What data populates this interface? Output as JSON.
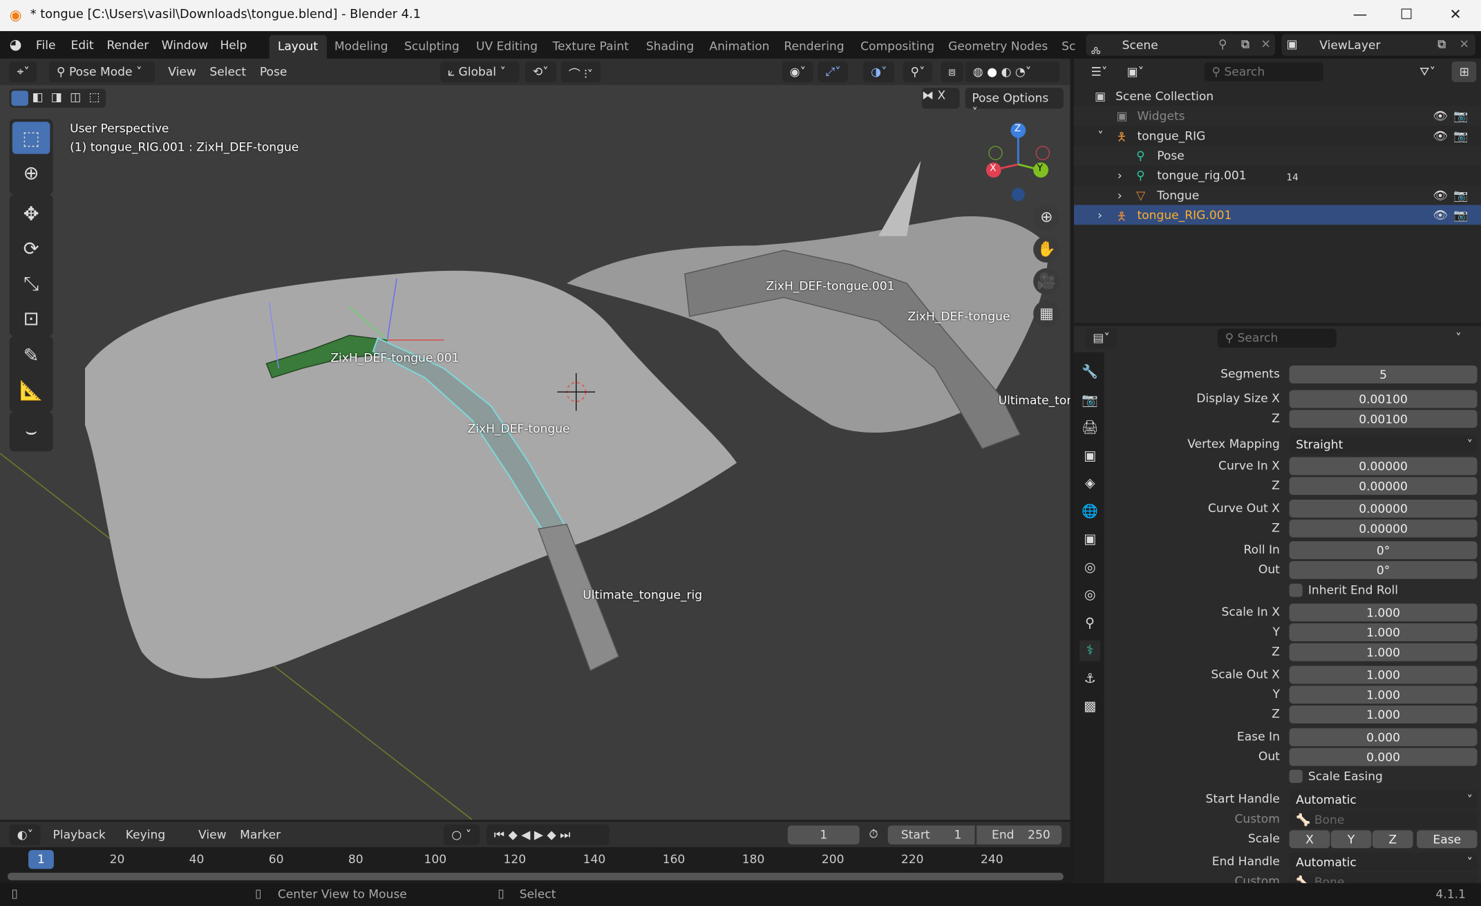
{
  "window": {
    "title": "* tongue [C:\\Users\\vasil\\Downloads\\tongue.blend] - Blender 4.1",
    "controls": [
      "minimize-icon",
      "maximize-icon",
      "close-icon"
    ]
  },
  "menubar": {
    "menus": [
      "File",
      "Edit",
      "Render",
      "Window",
      "Help"
    ],
    "workspaces": [
      "Layout",
      "Modeling",
      "Sculpting",
      "UV Editing",
      "Texture Paint",
      "Shading",
      "Animation",
      "Rendering",
      "Compositing",
      "Geometry Nodes",
      "Sc"
    ],
    "active_workspace": "Layout",
    "scene": "Scene",
    "view_layer": "ViewLayer"
  },
  "viewport_header": {
    "mode": "Pose Mode",
    "menus": [
      "View",
      "Select",
      "Pose"
    ],
    "orientation": "Global",
    "pose_options": "Pose Options",
    "x_mirror": "X"
  },
  "viewport": {
    "perspective": "User Perspective",
    "object_info": "(1) tongue_RIG.001 : ZixH_DEF-tongue",
    "bone_labels": [
      "ZixH_DEF-tongue.001",
      "ZixH_DEF-tongue",
      "Ultimate_tongue_rig",
      "ZixH_DEF-tongue.001",
      "ZixH_DEF-tongue",
      "Ultimate_tong"
    ],
    "axis_labels": {
      "x": "X",
      "y": "Y",
      "z": "Z"
    },
    "colors": {
      "selected_bone": "#7fd6d6",
      "active_bone_green": "#3a7a3a",
      "background": "#3d3d3d",
      "mesh": "#b5b5b5"
    }
  },
  "outliner": {
    "search_placeholder": "Search",
    "items": [
      {
        "label": "Scene Collection",
        "depth": 0
      },
      {
        "label": "Widgets",
        "depth": 1,
        "dim": true
      },
      {
        "label": "tongue_RIG",
        "depth": 1
      },
      {
        "label": "Pose",
        "depth": 2
      },
      {
        "label": "tongue_rig.001",
        "depth": 2,
        "badge": "14"
      },
      {
        "label": "Tongue",
        "depth": 2
      },
      {
        "label": "tongue_RIG.001",
        "depth": 1,
        "selected": true
      }
    ],
    "colors": {
      "selected_row": "#334d80",
      "active_text": "#ffaf29"
    }
  },
  "properties": {
    "search_placeholder": "Search",
    "rows": [
      {
        "label": "Segments",
        "value": "5"
      },
      {
        "label": "Display Size X",
        "value": "0.00100"
      },
      {
        "label": "Z",
        "value": "0.00100"
      },
      {
        "label": "Vertex Mapping",
        "value": "Straight",
        "type": "dropdown"
      },
      {
        "label": "Curve In X",
        "value": "0.00000"
      },
      {
        "label": "Z",
        "value": "0.00000"
      },
      {
        "label": "Curve Out X",
        "value": "0.00000"
      },
      {
        "label": "Z",
        "value": "0.00000"
      },
      {
        "label": "Roll In",
        "value": "0°"
      },
      {
        "label": "Out",
        "value": "0°"
      },
      {
        "label": "Inherit End Roll",
        "type": "checkbox",
        "checked": false
      },
      {
        "label": "Scale In X",
        "value": "1.000"
      },
      {
        "label": "Y",
        "value": "1.000"
      },
      {
        "label": "Z",
        "value": "1.000"
      },
      {
        "label": "Scale Out X",
        "value": "1.000"
      },
      {
        "label": "Y",
        "value": "1.000"
      },
      {
        "label": "Z",
        "value": "1.000"
      },
      {
        "label": "Ease In",
        "value": "0.000"
      },
      {
        "label": "Out",
        "value": "0.000"
      },
      {
        "label": "Scale Easing",
        "type": "checkbox",
        "checked": false
      },
      {
        "label": "Start Handle",
        "value": "Automatic",
        "type": "dropdown"
      },
      {
        "label": "Custom",
        "value": "Bone",
        "type": "bone"
      },
      {
        "label": "Scale",
        "type": "xyz",
        "buttons": [
          "X",
          "Y",
          "Z",
          "Ease"
        ]
      },
      {
        "label": "End Handle",
        "value": "Automatic",
        "type": "dropdown"
      },
      {
        "label": "Custom",
        "value": "Bone",
        "type": "bone"
      }
    ]
  },
  "timeline": {
    "menus": [
      "Playback",
      "Keying",
      "View",
      "Marker"
    ],
    "current_frame": "1",
    "start_label": "Start",
    "start": "1",
    "end_label": "End",
    "end": "250",
    "ticks": [
      "20",
      "40",
      "60",
      "80",
      "100",
      "120",
      "140",
      "160",
      "180",
      "200",
      "220",
      "240"
    ],
    "playhead": "1"
  },
  "statusbar": {
    "hints": [
      "Center View to Mouse",
      "Select"
    ],
    "version": "4.1.1"
  }
}
